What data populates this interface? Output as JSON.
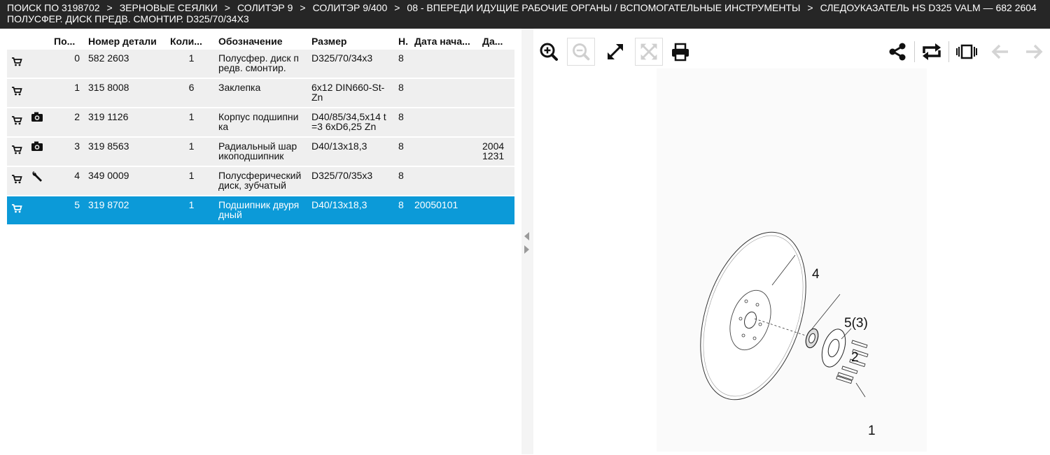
{
  "breadcrumb": {
    "items": [
      "ПОИСК ПО 3198702",
      "ЗЕРНОВЫЕ СЕЯЛКИ",
      "СОЛИТЭР 9",
      "СОЛИТЭР 9/400",
      "08 - ВПЕРЕДИ ИДУЩИЕ РАБОЧИЕ ОРГАНЫ / ВСПОМОГАТЕЛЬНЫЕ ИНСТРУМЕНТЫ",
      "СЛЕДОУКАЗАТЕЛЬ HS D325 VALM — 682 2604",
      "ПОЛУСФЕР. ДИСК ПРЕДВ. СМОНТИР. D325/70/34X3"
    ],
    "separator": ">"
  },
  "table": {
    "headers": [
      "По...",
      "Номер детали",
      "Коли...",
      "Обозначение",
      "Размер",
      "Н.",
      "Дата нача...",
      "Да..."
    ],
    "rows": [
      {
        "extra_icon": "",
        "pos": "0",
        "part": "582 2603",
        "qty": "1",
        "name": "Полусфер. диск п редв. смонтир.",
        "size": "D325/70/34x3",
        "n": "8",
        "date_start": "",
        "date_end": "",
        "selected": false
      },
      {
        "extra_icon": "",
        "pos": "1",
        "part": "315 8008",
        "qty": "6",
        "name": "Заклепка",
        "size": "6x12 DIN660-St-Zn",
        "n": "8",
        "date_start": "",
        "date_end": "",
        "selected": false
      },
      {
        "extra_icon": "camera-icon",
        "pos": "2",
        "part": "319 1126",
        "qty": "1",
        "name": "Корпус подшипни ка",
        "size": "D40/85/34,5x14 t =3 6xD6,25 Zn",
        "n": "8",
        "date_start": "",
        "date_end": "",
        "selected": false
      },
      {
        "extra_icon": "camera-icon",
        "pos": "3",
        "part": "319 8563",
        "qty": "1",
        "name": "Радиальный шар икоподшипник",
        "size": "D40/13x18,3",
        "n": "8",
        "date_start": "",
        "date_end": "2004 1231",
        "selected": false
      },
      {
        "extra_icon": "wrench-icon",
        "pos": "4",
        "part": "349 0009",
        "qty": "1",
        "name": "Полусферический диск, зубчатый",
        "size": "D325/70/35x3",
        "n": "8",
        "date_start": "",
        "date_end": "",
        "selected": false
      },
      {
        "extra_icon": "",
        "pos": "5",
        "part": "319 8702",
        "qty": "1",
        "name": "Подшипник двуря дный",
        "size": "D40/13x18,3",
        "n": "8",
        "date_start": "20050101",
        "date_end": "",
        "selected": true
      }
    ]
  },
  "drawing": {
    "callouts": [
      "4",
      "5(3)",
      "2",
      "1"
    ]
  },
  "colors": {
    "topbar": "#262626",
    "selected_row": "#0c9ad8",
    "row_bg": "#efefef"
  }
}
